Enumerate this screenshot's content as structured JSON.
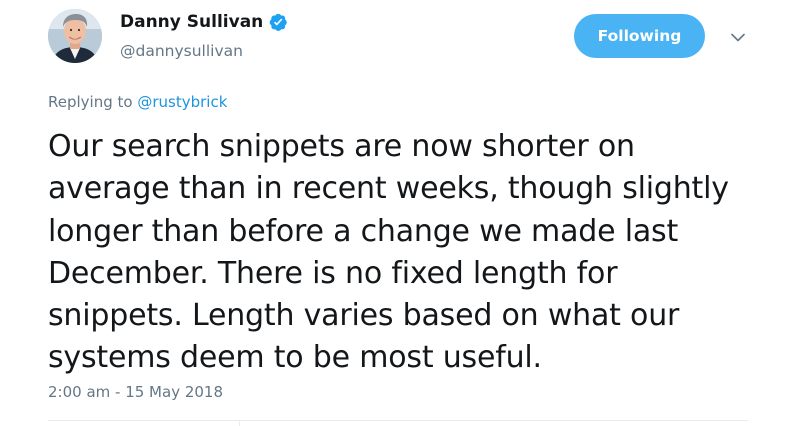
{
  "author": {
    "display_name": "Danny Sullivan",
    "handle": "@dannysullivan",
    "verified": true
  },
  "follow_button": {
    "label": "Following"
  },
  "reply": {
    "prefix": "Replying to ",
    "mention": "@rustybrick"
  },
  "tweet": {
    "lines": [
      "Our search snippets are now shorter on",
      "average than in recent weeks, though slightly",
      "longer than before a change we made last",
      "December. There is no fixed length for",
      "snippets. Length varies based on what our",
      "systems deem to be most useful."
    ],
    "timestamp": "2:00 am - 15 May 2018"
  },
  "icons": {
    "verified": "verified-badge-icon",
    "more": "chevron-down-icon"
  },
  "colors": {
    "accent": "#1b95e0",
    "follow_button": "#4ab3f4",
    "muted_text": "#657786",
    "primary_text": "#14171a",
    "divider": "#e6ecf0"
  }
}
